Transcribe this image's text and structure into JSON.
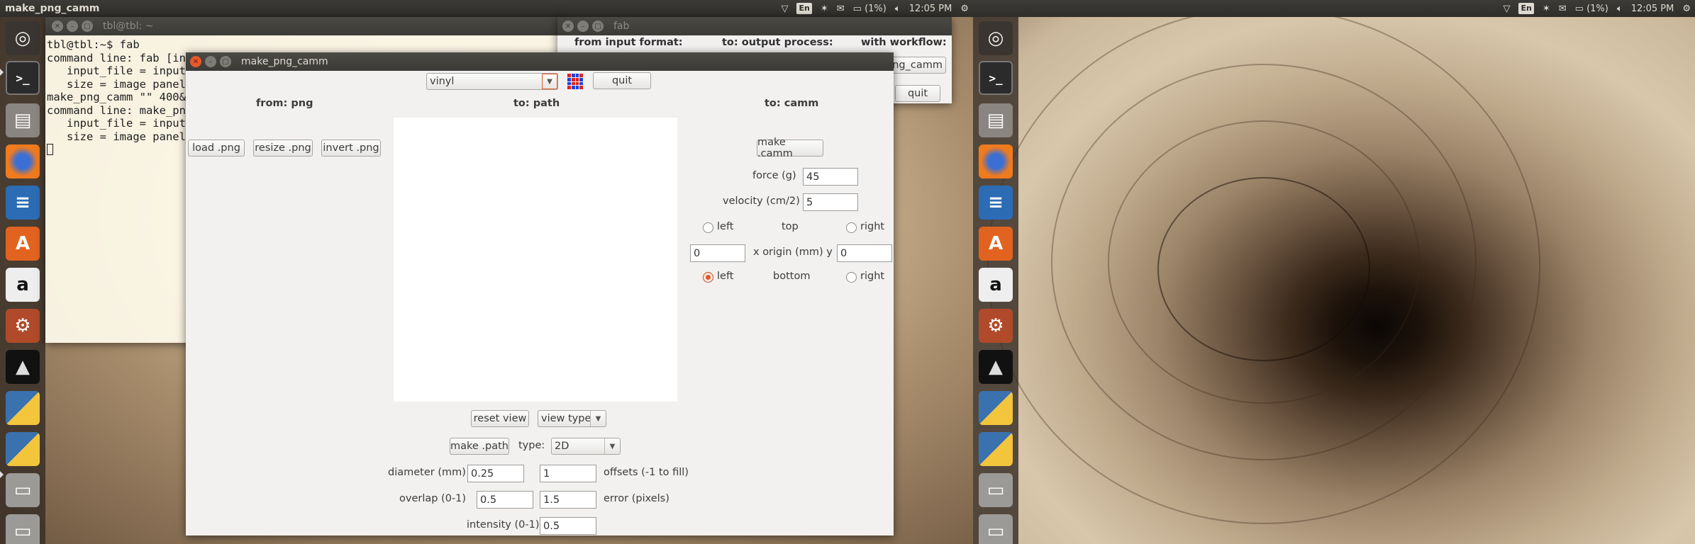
{
  "panel": {
    "app_title": "make_png_camm",
    "keyboard": "En",
    "battery": "(1%)",
    "clock": "12:05 PM"
  },
  "launcher": {
    "icons": [
      "dash-icon",
      "terminal-icon",
      "files-icon",
      "firefox-icon",
      "writer-icon",
      "software-center-icon",
      "amazon-icon",
      "settings-icon",
      "inkscape-icon",
      "python-icon",
      "python-icon",
      "drive-icon",
      "drive-icon"
    ]
  },
  "terminal": {
    "title": "tbl@tbl: ~",
    "lines": [
      "tbl@tbl:~$ fab",
      "command line: fab [inp",
      "   input_file = input",
      "   size = image panel",
      "make_png_camm \"\" 400&",
      "command line: make_png",
      "   input_file = input",
      "   size = image panel"
    ]
  },
  "fab": {
    "title": "fab",
    "from_input_format": "from input format:",
    "to_output_process": "to: output process:",
    "with_workflow": "with workflow:",
    "workflow_button": "png_camm",
    "quit": "quit"
  },
  "main": {
    "title": "make_png_camm",
    "material": "vinyl",
    "quit": "quit",
    "from_png": "from: png",
    "to_path": "to: path",
    "to_camm": "to: camm",
    "load_png": "load .png",
    "resize_png": "resize .png",
    "invert_png": "invert .png",
    "make_camm": "make .camm",
    "force_label": "force (g)",
    "force_value": "45",
    "velocity_label": "velocity (cm/2)",
    "velocity_value": "5",
    "left": "left",
    "top": "top",
    "right": "right",
    "x_origin_value": "0",
    "x_origin_label": "x  origin (mm)  y",
    "y_origin_value": "0",
    "bottom": "bottom",
    "bottom_left_selected": true,
    "reset_view": "reset view",
    "view_type": "view type",
    "make_path": "make .path",
    "type_label": "type:",
    "type_value": "2D",
    "diameter_label": "diameter (mm)",
    "diameter_value": "0.25",
    "offsets_value": "1",
    "offsets_label": "offsets (-1 to fill)",
    "overlap_label": "overlap (0-1)",
    "overlap_value": "0.5",
    "error_value": "1.5",
    "error_label": "error (pixels)",
    "intensity_label": "intensity (0-1)",
    "intensity_value": "0.5"
  }
}
